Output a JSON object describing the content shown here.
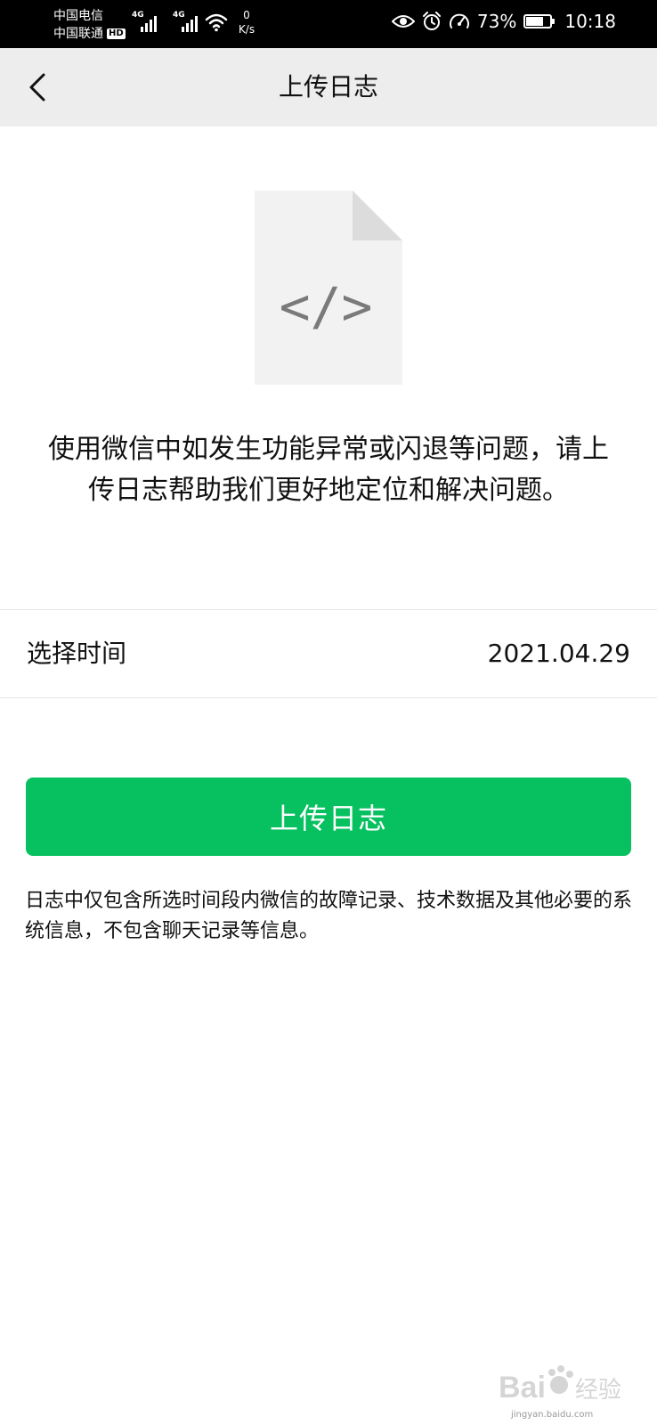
{
  "status_bar": {
    "carrier_1": "中国电信",
    "carrier_2": "中国联通",
    "hd_badge": "HD",
    "signal_1_tag": "4G",
    "signal_2_tag": "4G",
    "net_speed_value": "0",
    "net_speed_unit": "K/s",
    "battery_percent": "73%",
    "battery_level": 0.73,
    "time": "10:18",
    "icons": [
      "eye-icon",
      "alarm-icon",
      "speedometer-icon",
      "wifi-icon",
      "battery-icon"
    ]
  },
  "navbar": {
    "back_icon": "chevron-left-icon",
    "title": "上传日志"
  },
  "illustration": {
    "icon": "code-file-icon",
    "glyph": "</>"
  },
  "description_text": "使用微信中如发生功能异常或闪退等问题，请上传日志帮助我们更好地定位和解决问题。",
  "time_row": {
    "label": "选择时间",
    "value": "2021.04.29"
  },
  "upload_button": {
    "label": "上传日志",
    "color": "#07c160"
  },
  "note_text": "日志中仅包含所选时间段内微信的故障记录、技术数据及其他必要的系统信息，不包含聊天记录等信息。",
  "watermark": {
    "brand": "Bai du 经验",
    "caption": "jingyan.baidu.com"
  }
}
